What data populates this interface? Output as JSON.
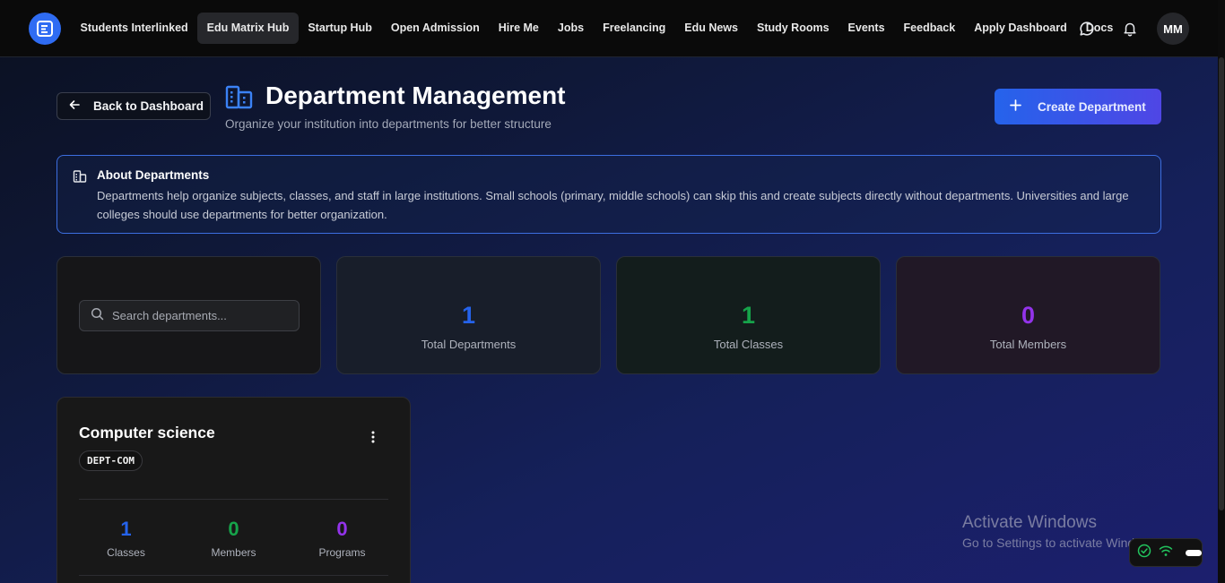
{
  "nav": {
    "logo_icon": "app-logo-icon",
    "items": [
      {
        "label": "Students Interlinked",
        "active": false
      },
      {
        "label": "Edu Matrix Hub",
        "active": true
      },
      {
        "label": "Startup Hub",
        "active": false
      },
      {
        "label": "Open Admission",
        "active": false
      },
      {
        "label": "Hire Me",
        "active": false
      },
      {
        "label": "Jobs",
        "active": false
      },
      {
        "label": "Freelancing",
        "active": false
      },
      {
        "label": "Edu News",
        "active": false
      },
      {
        "label": "Study Rooms",
        "active": false
      },
      {
        "label": "Events",
        "active": false
      },
      {
        "label": "Feedback",
        "active": false
      },
      {
        "label": "Apply Dashboard",
        "active": false
      },
      {
        "label": "Docs",
        "active": false
      }
    ],
    "avatar_initials": "MM"
  },
  "header": {
    "back_label": "Back to Dashboard",
    "title": "Department Management",
    "subtitle": "Organize your institution into departments for better structure",
    "create_label": "Create Department"
  },
  "info": {
    "title": "About Departments",
    "text": "Departments help organize subjects, classes, and staff in large institutions. Small schools (primary, middle schools) can skip this and create subjects directly without departments. Universities and large colleges should use departments for better organization."
  },
  "search": {
    "placeholder": "Search departments...",
    "value": ""
  },
  "stats": {
    "departments": {
      "value": "1",
      "label": "Total Departments"
    },
    "classes": {
      "value": "1",
      "label": "Total Classes"
    },
    "members": {
      "value": "0",
      "label": "Total Members"
    }
  },
  "departments": [
    {
      "name": "Computer science",
      "code": "DEPT-COM",
      "classes": {
        "value": "1",
        "label": "Classes"
      },
      "members": {
        "value": "0",
        "label": "Members"
      },
      "programs": {
        "value": "0",
        "label": "Programs"
      }
    }
  ],
  "watermark": {
    "title": "Activate Windows",
    "subtitle": "Go to Settings to activate Windows."
  },
  "colors": {
    "accent_blue": "#2f6cf3",
    "stat_blue": "#2563eb",
    "stat_green": "#16a34a",
    "stat_purple": "#9333ea"
  }
}
